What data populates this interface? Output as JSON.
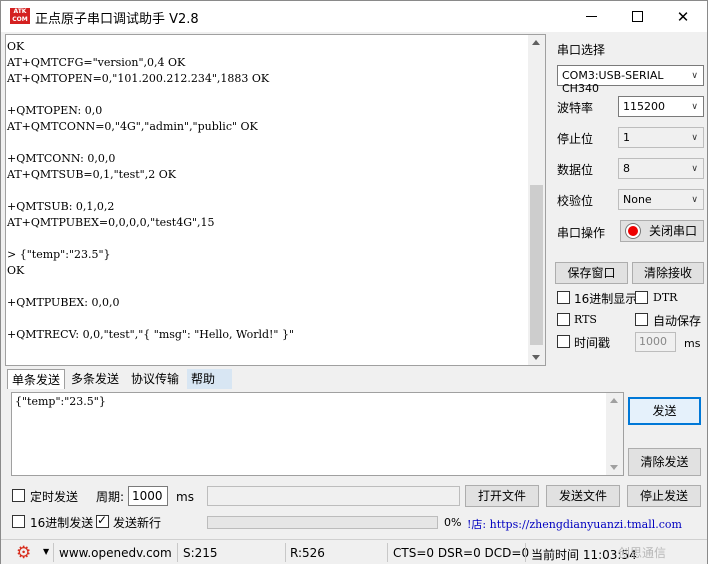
{
  "window": {
    "logo_text": "ATK\nCOM",
    "title": "正点原子串口调试助手 V2.8",
    "min_glyph": "—",
    "max_glyph": "☐",
    "close_glyph": "✕"
  },
  "receive": {
    "lines": [
      "OK",
      "AT+QMTCFG=\"version\",0,4 OK",
      "AT+QMTOPEN=0,\"101.200.212.234\",1883 OK",
      "",
      "+QMTOPEN: 0,0",
      "AT+QMTCONN=0,\"4G\",\"admin\",\"public\" OK",
      "",
      "+QMTCONN: 0,0,0",
      "AT+QMTSUB=0,1,\"test\",2 OK",
      "",
      "+QMTSUB: 0,1,0,2",
      "AT+QMTPUBEX=0,0,0,0,\"test4G\",15",
      "",
      "> {\"temp\":\"23.5\"}",
      "OK",
      "",
      "+QMTPUBEX: 0,0,0",
      "",
      "+QMTRECV: 0,0,\"test\",\"{ \"msg\": \"Hello, World!\" }\""
    ]
  },
  "right_panel": {
    "port_select_label": "串口选择",
    "port_value": "COM3:USB-SERIAL CH340",
    "baud_label": "波特率",
    "baud_value": "115200",
    "stop_label": "停止位",
    "stop_value": "1",
    "data_label": "数据位",
    "data_value": "8",
    "parity_label": "校验位",
    "parity_value": "None",
    "port_op_label": "串口操作",
    "close_port_label": "关闭串口",
    "save_window_label": "保存窗口",
    "clear_recv_label": "清除接收",
    "hex_display_label": "16进制显示",
    "dtr_label": "DTR",
    "rts_label": "RTS",
    "auto_save_label": "自动保存",
    "timestamp_label": "时间戳",
    "timestamp_value": "1000",
    "ms_label": "ms"
  },
  "tabs": [
    "单条发送",
    "多条发送",
    "协议传输",
    "帮助"
  ],
  "send": {
    "text": "{\"temp\":\"23.5\"}",
    "send_label": "发送",
    "clear_send_label": "清除发送",
    "timed_send_label": "定时发送",
    "period_label": "周期:",
    "period_value": "1000",
    "ms_label": "ms",
    "open_file_label": "打开文件",
    "send_file_label": "发送文件",
    "stop_send_label": "停止发送",
    "hex_send_label": "16进制发送",
    "send_newline_label": "发送新行",
    "progress_text": "0%",
    "progress_value": 0,
    "link_text": "!店: https://zhengdianyuanzi.tmall.com"
  },
  "status": {
    "website": "www.openedv.com",
    "sent": "S:215",
    "received": "R:526",
    "signals": "CTS=0 DSR=0 DCD=0",
    "time": "当前时间 11:03:54",
    "watermark": "创思通信"
  },
  "icons": {
    "gear": "gear-icon",
    "led": "red-led-icon"
  },
  "colors": {
    "accent": "#0078d7",
    "gear": "#d82c1c",
    "led": "#ee0000",
    "link": "#0000c0"
  }
}
